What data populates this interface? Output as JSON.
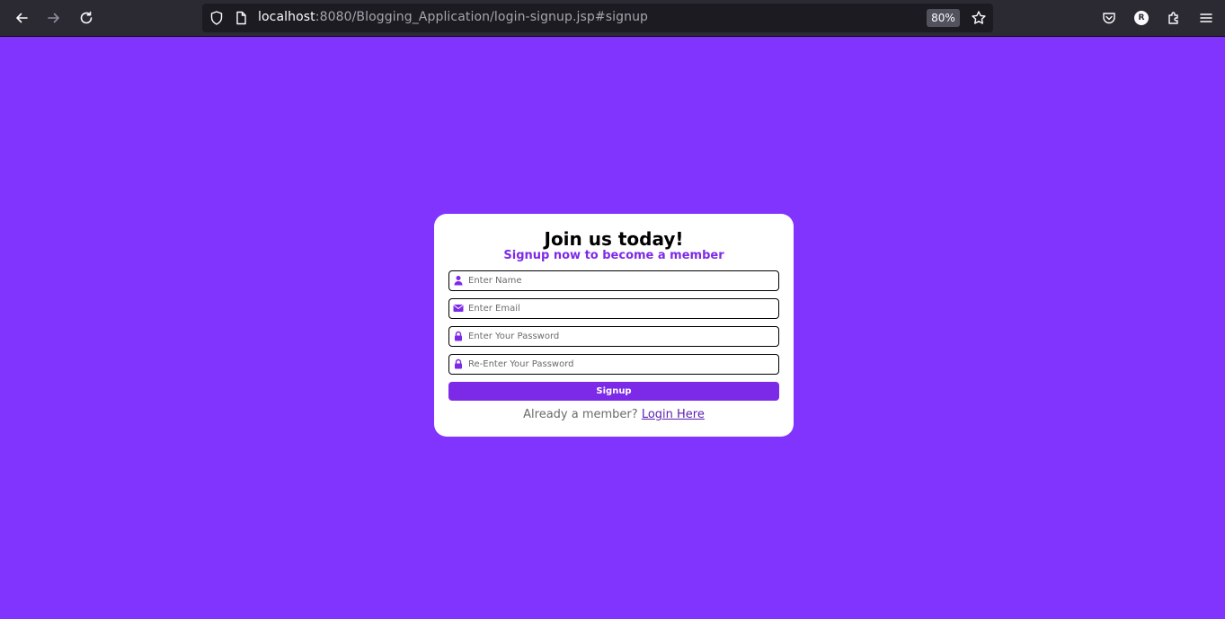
{
  "browser": {
    "url_host": "localhost",
    "url_rest": ":8080/Blogging_Application/login-signup.jsp#signup",
    "zoom": "80%",
    "avatar_letter": "R",
    "icons": [
      "back-arrow-icon",
      "forward-arrow-icon",
      "reload-icon",
      "shield-icon",
      "page-icon",
      "star-icon",
      "pocket-icon",
      "extensions-icon",
      "menu-icon"
    ]
  },
  "page": {
    "background": "#8034fd",
    "accent": "#7d2ae8"
  },
  "signup": {
    "title": "Join us today!",
    "subtitle": "Signup now to become a member",
    "fields": {
      "name_placeholder": "Enter Name",
      "email_placeholder": "Enter Email",
      "password_placeholder": "Enter Your Password",
      "repassword_placeholder": "Re-Enter Your Password"
    },
    "button_label": "Signup",
    "footer_text": "Already a member?",
    "login_link": "Login Here"
  }
}
